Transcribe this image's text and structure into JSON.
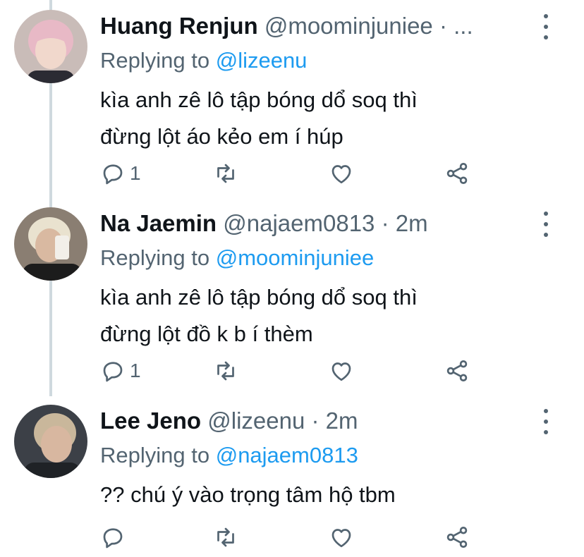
{
  "tweets": [
    {
      "name": "Huang Renjun",
      "handle": "@moominjuniee",
      "separator": "·",
      "time": "...",
      "replying_prefix": "Replying to",
      "replying_to": "@lizeenu",
      "text_line1": "kìa anh zê lô tập bóng dổ soq thì",
      "text_line2": "đừng lột áo kẻo em í húp",
      "reply_count": "1",
      "avatar_colors": {
        "bg": "#c9bcb8",
        "hair": "#e8b9c6",
        "skin": "#f1d8cc",
        "shirt": "#2b2b33"
      }
    },
    {
      "name": "Na Jaemin",
      "handle": "@najaem0813",
      "separator": "·",
      "time": "2m",
      "replying_prefix": "Replying to",
      "replying_to": "@moominjuniee",
      "text_line1": "kìa anh zê lô tập bóng dổ soq thì",
      "text_line2": "đừng lột đồ k b í thèm",
      "reply_count": "1",
      "avatar_colors": {
        "bg": "#8a7e72",
        "hair": "#e9e2cf",
        "skin": "#d9b9a1",
        "shirt": "#1c1c1c"
      }
    },
    {
      "name": "Lee Jeno",
      "handle": "@lizeenu",
      "separator": "·",
      "time": "2m",
      "replying_prefix": "Replying to",
      "replying_to": "@najaem0813",
      "text_line1": "?? chú ý vào trọng tâm hộ tbm",
      "text_line2": "",
      "reply_count": "",
      "avatar_colors": {
        "bg": "#3c4047",
        "hair": "#c9b79b",
        "skin": "#d8b7a0",
        "shirt": "#1f2226"
      }
    }
  ],
  "colors": {
    "text": "#0f1419",
    "muted": "#536471",
    "link": "#1d9bf0",
    "thread_line": "#cfd9de"
  },
  "icons": [
    "reply-icon",
    "retweet-icon",
    "like-icon",
    "share-icon",
    "more-icon"
  ]
}
